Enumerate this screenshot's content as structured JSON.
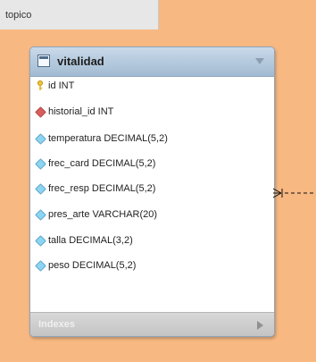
{
  "layer": {
    "name": "topico",
    "background_color": "#f7b882"
  },
  "table": {
    "name": "vitalidad",
    "header_color": "#b3c9dd",
    "columns": [
      {
        "text": "id INT",
        "kind": "primary-key",
        "icon": "key-icon"
      },
      {
        "text": "historial_id INT",
        "kind": "foreign-key",
        "icon": "foreign-key-diamond-icon"
      },
      {
        "text": "temperatura DECIMAL(5,2)",
        "kind": "column",
        "icon": "column-diamond-icon"
      },
      {
        "text": "frec_card DECIMAL(5,2)",
        "kind": "column",
        "icon": "column-diamond-icon"
      },
      {
        "text": "frec_resp DECIMAL(5,2)",
        "kind": "column",
        "icon": "column-diamond-icon"
      },
      {
        "text": "pres_arte VARCHAR(20)",
        "kind": "column",
        "icon": "column-diamond-icon"
      },
      {
        "text": "talla DECIMAL(3,2)",
        "kind": "column",
        "icon": "column-diamond-icon"
      },
      {
        "text": "peso DECIMAL(5,2)",
        "kind": "column",
        "icon": "column-diamond-icon"
      }
    ],
    "indexes_label": "Indexes"
  },
  "relationship": {
    "type": "one-to-many",
    "icon": "relationship-connector-icon"
  }
}
